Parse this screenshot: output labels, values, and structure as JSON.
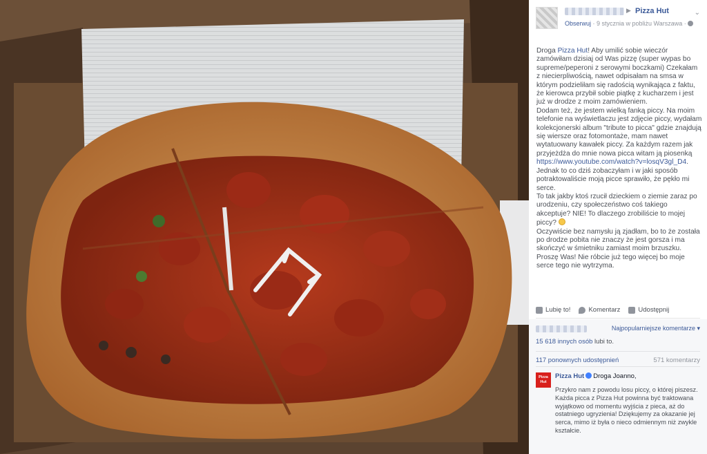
{
  "post": {
    "page_name": "Pizza Hut",
    "follow_label": "Obserwuj",
    "meta_text": " · 9 stycznia w pobliżu Warszawa · ",
    "paragraphs": [
      {
        "before": "Droga ",
        "link": "Pizza Hut",
        "after": "! Aby umilić sobie wieczór zamówiłam dzisiaj od Was pizzę (super wypas bo supreme/peperoni z serowymi boczkami) Czekałam z niecierpliwością, nawet odpisałam na smsa w którym podzieliłam się radością wynikająca z faktu, że kierowca przybił sobie piątkę z kucharzem i jest już w drodze z moim zamówieniem."
      },
      {
        "before": "Dodam też, że jestem wielką fanką piccy. Na moim telefonie na wyświetlaczu jest zdjęcie piccy, wydałam kolekcjonerski album \"tribute to picca\" gdzie znajdują się wiersze oraz fotomontaże, mam nawet wytatuowany kawałek piccy. Za każdym razem jak przyjeżdża do mnie nowa picca witam ją piosenką ",
        "link": "https://www.youtube.com/watch?v=losqV3gl_D4",
        "after": "."
      },
      {
        "before": "Jednak to co dziś zobaczyłam i w jaki sposób potraktowaliście moją picce sprawiło, że pękło mi serce.",
        "link": "",
        "after": ""
      },
      {
        "before": "To tak jakby ktoś rzucił dzieckiem o ziemie zaraz po urodzeniu, czy społeczeństwo coś takiego akceptuje? NIE! To dlaczego zrobiliście to mojej piccy? ",
        "link": "",
        "after": ""
      },
      {
        "before": "Oczywiście bez namysłu ją zjadłam, bo to że została po drodze pobita nie znaczy że jest gorsza i ma skończyć w śmietniku zamiast moim brzuszku. Proszę Was! Nie róbcie już tego więcej bo moje serce tego nie wytrzyma.",
        "link": "",
        "after": ""
      }
    ]
  },
  "actions": {
    "like": "Lubię to!",
    "comment": "Komentarz",
    "share": "Udostępnij"
  },
  "feedback": {
    "sort_label": "Najpopularniejsze komentarze ▾",
    "likes_link": "15 618 innych osób",
    "likes_suffix": " lubi to.",
    "shares": "117 ponownych udostępnień",
    "comments": "571 komentarzy"
  },
  "reply": {
    "author": "Pizza Hut",
    "greeting": "Droga Joanno,",
    "logo_text": "Pizza Hut",
    "body": "Przykro nam z powodu losu piccy, o której piszesz. Każda picca z Pizza Hut powinna być traktowana wyjątkowo od momentu wyjścia z pieca, aż do ostatniego ugryzienia! Dziękujemy za okazanie jej serca, mimo iż była o nieco odmiennym niż zwykle kształcie."
  },
  "colors": {
    "link": "#3b5998",
    "text": "#4b4f56",
    "muted": "#90949c",
    "brand_red": "#d8201c"
  }
}
